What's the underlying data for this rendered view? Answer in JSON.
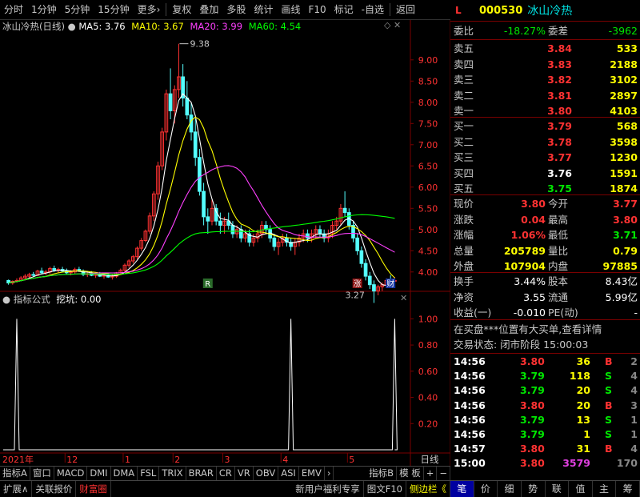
{
  "toolbar": {
    "items": [
      "分时",
      "1分钟",
      "5分钟",
      "15分钟",
      "更多›",
      "复权",
      "叠加",
      "多股",
      "统计",
      "画线",
      "F10",
      "标记",
      "-自选",
      "返回"
    ]
  },
  "stock": {
    "marker": "L",
    "code": "000530",
    "name": "冰山冷热"
  },
  "chart_header": {
    "name": "冰山冷热(日线)",
    "ma5_label": "MA5: 3.76",
    "ma10_label": "MA10: 3.67",
    "ma20_label": "MA20: 3.99",
    "ma60_label": "MA60: 4.54",
    "colors": {
      "ma5": "#ffffff",
      "ma10": "#ffff00",
      "ma20": "#ff40ff",
      "ma60": "#00ff00",
      "up": "#ff3232",
      "down": "#54ffff"
    }
  },
  "indicator_header": {
    "name": "指标公式",
    "value_label": "挖坑: 0.00"
  },
  "chart_data": [
    {
      "type": "candlestick",
      "title": "冰山冷热(日线)",
      "y_ticks": [
        "9.00",
        "8.50",
        "8.00",
        "7.50",
        "7.00",
        "6.50",
        "6.00",
        "5.50",
        "5.00",
        "4.50",
        "4.00"
      ],
      "ylim": [
        3.6,
        9.6
      ],
      "annotations": [
        {
          "text": "9.38",
          "price": 9.38
        },
        {
          "text": "3.27",
          "price": 3.27
        }
      ],
      "markers": [
        "R",
        "涨",
        "财"
      ],
      "x_labels": [
        "2021年",
        "12",
        "1",
        "2",
        "3",
        "4",
        "5"
      ],
      "candles": [
        [
          3.8,
          3.82,
          3.7,
          3.74
        ],
        [
          3.74,
          3.8,
          3.7,
          3.78
        ],
        [
          3.78,
          3.85,
          3.75,
          3.8
        ],
        [
          3.8,
          3.9,
          3.78,
          3.86
        ],
        [
          3.86,
          3.95,
          3.82,
          3.9
        ],
        [
          3.9,
          3.98,
          3.86,
          3.94
        ],
        [
          3.94,
          4.0,
          3.88,
          3.92
        ],
        [
          3.92,
          4.05,
          3.9,
          4.02
        ],
        [
          4.02,
          4.1,
          3.95,
          3.98
        ],
        [
          3.98,
          4.05,
          3.92,
          4.0
        ],
        [
          4.0,
          4.12,
          3.96,
          4.08
        ],
        [
          4.08,
          4.15,
          4.0,
          4.04
        ],
        [
          4.04,
          4.1,
          3.98,
          4.06
        ],
        [
          4.06,
          4.12,
          4.0,
          4.02
        ],
        [
          4.02,
          4.08,
          3.94,
          3.98
        ],
        [
          3.98,
          4.04,
          3.92,
          4.0
        ],
        [
          4.0,
          4.1,
          3.96,
          4.06
        ],
        [
          4.06,
          4.12,
          4.0,
          4.02
        ],
        [
          4.02,
          4.06,
          3.9,
          3.94
        ],
        [
          3.94,
          4.0,
          3.88,
          3.96
        ],
        [
          3.96,
          4.02,
          3.9,
          3.92
        ],
        [
          3.92,
          3.98,
          3.86,
          3.94
        ],
        [
          3.94,
          4.0,
          3.88,
          3.9
        ],
        [
          3.9,
          3.96,
          3.84,
          3.92
        ],
        [
          3.92,
          3.98,
          3.86,
          3.88
        ],
        [
          3.88,
          3.94,
          3.82,
          3.9
        ],
        [
          3.9,
          4.0,
          3.86,
          3.98
        ],
        [
          3.98,
          4.08,
          3.94,
          4.04
        ],
        [
          4.04,
          4.2,
          4.0,
          4.16
        ],
        [
          4.16,
          4.3,
          4.1,
          4.26
        ],
        [
          4.26,
          4.4,
          4.2,
          4.36
        ],
        [
          4.36,
          4.6,
          4.3,
          4.56
        ],
        [
          4.56,
          4.8,
          4.5,
          4.74
        ],
        [
          4.74,
          5.0,
          4.7,
          4.96
        ],
        [
          4.96,
          5.4,
          4.9,
          5.32
        ],
        [
          5.32,
          5.9,
          5.2,
          5.84
        ],
        [
          5.84,
          6.6,
          5.7,
          6.5
        ],
        [
          6.5,
          7.4,
          6.4,
          7.3
        ],
        [
          7.3,
          8.3,
          7.1,
          8.2
        ],
        [
          8.2,
          8.8,
          7.6,
          7.8
        ],
        [
          7.8,
          8.4,
          7.5,
          8.3
        ],
        [
          8.3,
          9.38,
          8.1,
          8.6
        ],
        [
          8.6,
          8.9,
          7.9,
          8.1
        ],
        [
          8.1,
          8.5,
          7.6,
          7.7
        ],
        [
          7.7,
          8.0,
          7.1,
          7.3
        ],
        [
          7.3,
          7.6,
          6.5,
          6.7
        ],
        [
          6.7,
          6.9,
          5.8,
          5.9
        ],
        [
          5.9,
          6.1,
          5.1,
          5.3
        ],
        [
          5.3,
          5.5,
          4.9,
          5.2
        ],
        [
          5.2,
          5.7,
          5.1,
          5.5
        ],
        [
          5.5,
          5.6,
          5.1,
          5.2
        ],
        [
          5.2,
          5.4,
          4.9,
          5.1
        ],
        [
          5.1,
          5.3,
          4.9,
          5.2
        ],
        [
          5.2,
          5.4,
          5.0,
          5.1
        ],
        [
          5.1,
          5.2,
          4.8,
          4.9
        ],
        [
          4.9,
          5.1,
          4.8,
          5.0
        ],
        [
          5.0,
          5.1,
          4.7,
          4.8
        ],
        [
          4.8,
          5.0,
          4.7,
          4.9
        ],
        [
          4.9,
          5.0,
          4.6,
          4.7
        ],
        [
          4.7,
          4.9,
          4.6,
          4.8
        ],
        [
          4.8,
          5.0,
          4.7,
          4.9
        ],
        [
          4.9,
          5.2,
          4.8,
          5.1
        ],
        [
          5.1,
          5.2,
          4.9,
          5.0
        ],
        [
          5.0,
          5.1,
          4.7,
          4.8
        ],
        [
          4.8,
          4.9,
          4.5,
          4.6
        ],
        [
          4.6,
          4.8,
          4.4,
          4.7
        ],
        [
          4.7,
          4.9,
          4.6,
          4.8
        ],
        [
          4.8,
          4.9,
          4.6,
          4.7
        ],
        [
          4.7,
          4.8,
          4.5,
          4.6
        ],
        [
          4.6,
          4.8,
          4.4,
          4.7
        ],
        [
          4.7,
          4.9,
          4.6,
          4.8
        ],
        [
          4.8,
          5.0,
          4.7,
          4.9
        ],
        [
          4.9,
          5.0,
          4.7,
          4.8
        ],
        [
          4.8,
          5.0,
          4.7,
          4.9
        ],
        [
          4.9,
          5.1,
          4.8,
          5.0
        ],
        [
          5.0,
          5.1,
          4.8,
          4.9
        ],
        [
          4.9,
          5.0,
          4.7,
          4.8
        ],
        [
          4.8,
          5.0,
          4.7,
          4.9
        ],
        [
          4.9,
          5.2,
          4.8,
          5.1
        ],
        [
          5.1,
          5.3,
          5.0,
          5.2
        ],
        [
          5.2,
          5.6,
          5.1,
          5.5
        ],
        [
          5.5,
          5.9,
          5.3,
          5.4
        ],
        [
          5.4,
          5.5,
          5.0,
          5.1
        ],
        [
          5.1,
          5.2,
          4.7,
          4.8
        ],
        [
          4.8,
          4.9,
          4.4,
          4.5
        ],
        [
          4.5,
          4.6,
          4.1,
          4.2
        ],
        [
          4.2,
          4.3,
          3.8,
          3.9
        ],
        [
          3.9,
          4.0,
          3.6,
          3.7
        ],
        [
          3.7,
          3.8,
          3.27,
          3.55
        ],
        [
          3.55,
          3.7,
          3.45,
          3.65
        ],
        [
          3.65,
          3.75,
          3.55,
          3.7
        ],
        [
          3.7,
          3.85,
          3.62,
          3.8
        ],
        [
          3.8,
          3.92,
          3.72,
          3.78
        ],
        [
          3.78,
          3.88,
          3.7,
          3.8
        ]
      ]
    },
    {
      "type": "line",
      "title": "挖坑",
      "y_ticks": [
        "1.00",
        "0.80",
        "0.60",
        "0.40",
        "0.20"
      ],
      "ylim": [
        0,
        1.1
      ],
      "spikes": [
        2,
        68,
        93
      ]
    }
  ],
  "x_axis_right_label": "日线",
  "indicator_tabs": [
    "指标A",
    "窗口",
    "MACD",
    "DMI",
    "DMA",
    "FSL",
    "TRIX",
    "BRAR",
    "CR",
    "VR",
    "OBV",
    "ASI",
    "EMV",
    "›",
    "指标B",
    "模 板",
    "+",
    "−"
  ],
  "bottom_bar": {
    "left": [
      "扩展∧",
      "关联报价",
      "财富圈"
    ],
    "right": [
      "新用户福利专享",
      "图文F10",
      "侧边栏《"
    ]
  },
  "quote": {
    "weibi_label": "委比",
    "weibi": "-18.27%",
    "weicha_label": "委差",
    "weicha": "-3962",
    "asks": [
      {
        "label": "卖五",
        "price": "3.84",
        "vol": "533"
      },
      {
        "label": "卖四",
        "price": "3.83",
        "vol": "2188"
      },
      {
        "label": "卖三",
        "price": "3.82",
        "vol": "3102"
      },
      {
        "label": "卖二",
        "price": "3.81",
        "vol": "2897"
      },
      {
        "label": "卖一",
        "price": "3.80",
        "vol": "4103"
      }
    ],
    "bids": [
      {
        "label": "买一",
        "price": "3.79",
        "vol": "568"
      },
      {
        "label": "买二",
        "price": "3.78",
        "vol": "3598"
      },
      {
        "label": "买三",
        "price": "3.77",
        "vol": "1230"
      },
      {
        "label": "买四",
        "price": "3.76",
        "vol": "1591"
      },
      {
        "label": "买五",
        "price": "3.75",
        "vol": "1874"
      }
    ],
    "stats": [
      {
        "l1": "现价",
        "v1": "3.80",
        "l2": "今开",
        "v2": "3.77"
      },
      {
        "l1": "涨跌",
        "v1": "0.04",
        "l2": "最高",
        "v2": "3.80"
      },
      {
        "l1": "涨幅",
        "v1": "1.06%",
        "l2": "最低",
        "v2": "3.71"
      },
      {
        "l1": "总量",
        "v1": "205789",
        "l2": "量比",
        "v2": "0.79"
      },
      {
        "l1": "外盘",
        "v1": "107904",
        "l2": "内盘",
        "v2": "97885"
      }
    ],
    "stats2": [
      {
        "l1": "换手",
        "v1": "3.44%",
        "l2": "股本",
        "v2": "8.43亿"
      },
      {
        "l1": "净资",
        "v1": "3.55",
        "l2": "流通",
        "v2": "5.99亿"
      },
      {
        "l1": "收益(一)",
        "v1": "-0.010",
        "l2": "PE(动)",
        "v2": "-"
      }
    ],
    "notice": "在买盘***位置有大买单,查看详情",
    "trade_status": "交易状态: 闭市阶段 15:00:03"
  },
  "ticks": [
    {
      "t": "14:56",
      "p": "3.80",
      "v": "36",
      "s": "B",
      "n": "2"
    },
    {
      "t": "14:56",
      "p": "3.79",
      "v": "118",
      "s": "S",
      "n": "4"
    },
    {
      "t": "14:56",
      "p": "3.79",
      "v": "20",
      "s": "S",
      "n": "4"
    },
    {
      "t": "14:56",
      "p": "3.80",
      "v": "20",
      "s": "B",
      "n": "3"
    },
    {
      "t": "14:56",
      "p": "3.79",
      "v": "13",
      "s": "S",
      "n": "1"
    },
    {
      "t": "14:56",
      "p": "3.79",
      "v": "1",
      "s": "S",
      "n": "1"
    },
    {
      "t": "14:57",
      "p": "3.80",
      "v": "31",
      "s": "B",
      "n": "4"
    },
    {
      "t": "15:00",
      "p": "3.80",
      "v": "3579",
      "s": "",
      "n": "170"
    }
  ],
  "right_tabs": [
    "笔",
    "价",
    "细",
    "势",
    "联",
    "值",
    "主",
    "筹"
  ]
}
